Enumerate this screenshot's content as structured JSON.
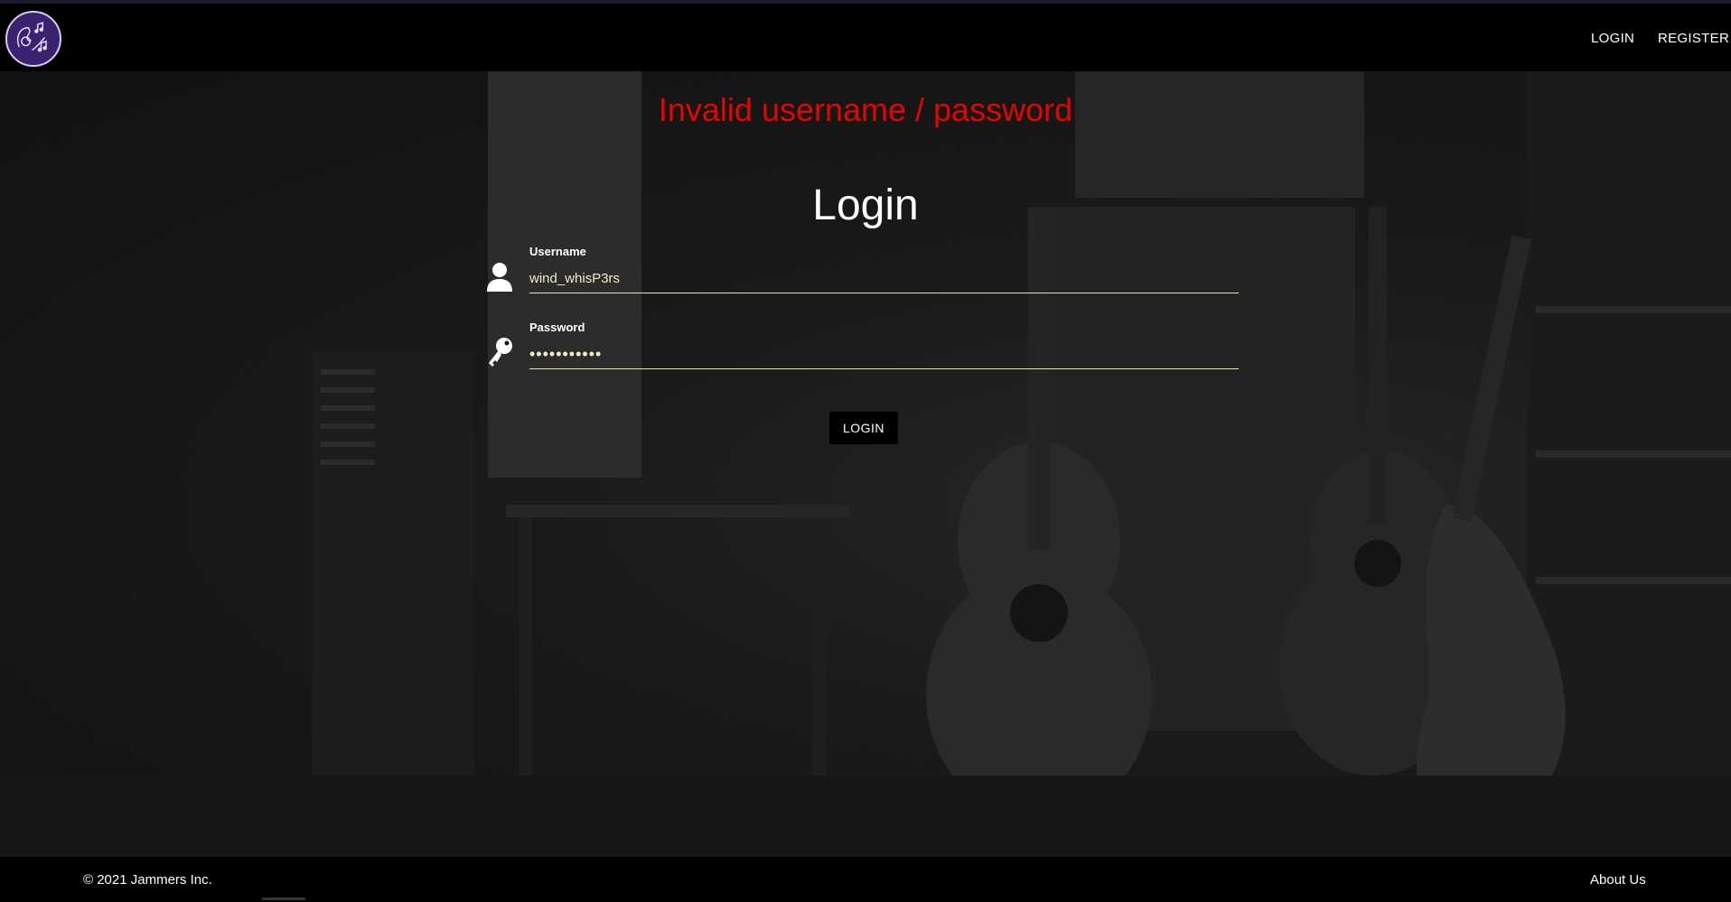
{
  "nav": {
    "logo_icon": "music-hand-logo-icon",
    "login_label": "LOGIN",
    "register_label": "REGISTER"
  },
  "login": {
    "error_message": "Invalid username / password",
    "title": "Login",
    "username_label": "Username",
    "username_value": "wind_whisP3rs",
    "username_icon": "user-icon",
    "password_label": "Password",
    "password_value": "•••••••••••",
    "password_icon": "key-icon",
    "submit_label": "LOGIN"
  },
  "footer": {
    "copyright": "© 2021 Jammers Inc.",
    "about_label": "About Us"
  },
  "colors": {
    "error": "#e10600",
    "input_underline": "#e9e3b4",
    "input_text": "#f2ecc7",
    "logo_bg": "#3b2170"
  }
}
